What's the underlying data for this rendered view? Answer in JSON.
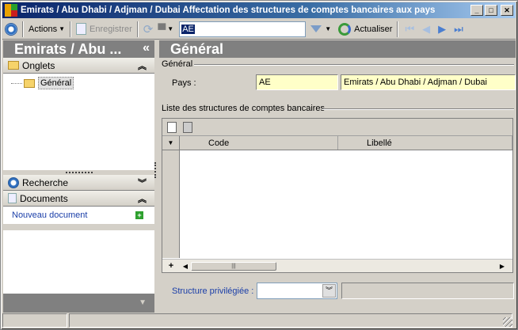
{
  "window": {
    "title": "Emirats / Abu Dhabi / Adjman / Dubai  Affectation des structures de comptes bancaires aux pays",
    "buttons": [
      "_",
      "□",
      "✕"
    ]
  },
  "toolbar": {
    "actions_label": "Actions",
    "save_label": "Enregistrer",
    "search_value": "AE",
    "refresh_label": "Actualiser"
  },
  "left": {
    "header": "Emirats / Abu ...",
    "collapse_glyph": "«",
    "tabs_section": "Onglets",
    "tree_item": "Général",
    "search_section": "Recherche",
    "documents_section": "Documents",
    "new_document": "Nouveau document"
  },
  "right": {
    "header": "Général",
    "group_general": "Général",
    "country_label": "Pays :",
    "country_code": "AE",
    "country_name": "Emirats / Abu Dhabi / Adjman / Dubai",
    "list_title": "Liste des structures de comptes bancaires",
    "columns": [
      "Code",
      "Libellé"
    ],
    "preferred_label": "Structure privilégiée :"
  },
  "colors": {
    "title_gradient_start": "#0a246a",
    "panel_header": "#808080",
    "field_bg": "#ffffc8",
    "link": "#1a3ea8"
  }
}
